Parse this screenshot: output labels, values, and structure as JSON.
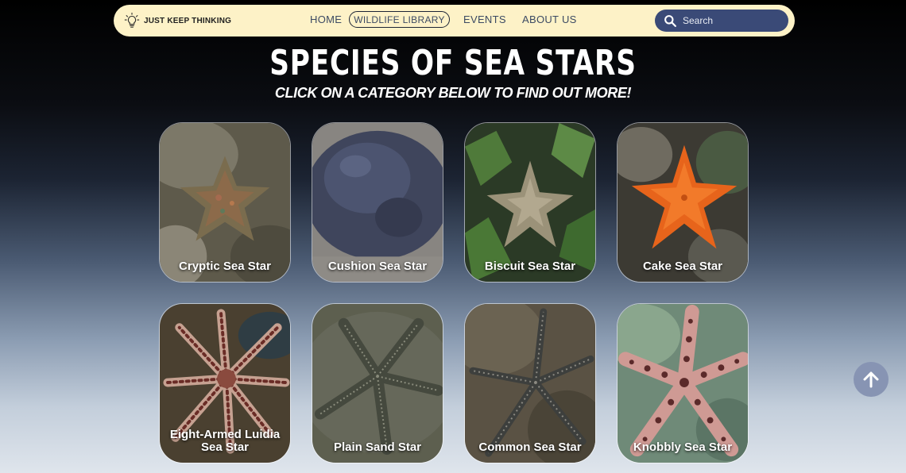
{
  "header": {
    "logo_text": "JUST KEEP THINKING",
    "nav": [
      {
        "label": "HOME"
      },
      {
        "label": "WILDLIFE LIBRARY",
        "active": true
      },
      {
        "label": "EVENTS"
      },
      {
        "label": "ABOUT US"
      }
    ],
    "search": {
      "placeholder": "Search"
    }
  },
  "page": {
    "title": "SPECIES OF SEA STARS",
    "subtitle": "CLICK ON A CATEGORY BELOW TO FIND OUT MORE!"
  },
  "species": [
    {
      "line1": "Cryptic Sea Star",
      "line2": ""
    },
    {
      "line1": "Cushion Sea Star",
      "line2": ""
    },
    {
      "line1": "Biscuit Sea Star",
      "line2": ""
    },
    {
      "line1": "Cake Sea Star",
      "line2": ""
    },
    {
      "line1": "Eight-Armed Luidia",
      "line2": "Sea Star"
    },
    {
      "line1": "Plain Sand Star",
      "line2": ""
    },
    {
      "line1": "Common Sea Star",
      "line2": ""
    },
    {
      "line1": "Knobbly Sea Star",
      "line2": ""
    }
  ],
  "colors": {
    "navbar_bg": "#fdf2c7",
    "search_bg": "#3a4a77",
    "scroll_button_bg": "#8794b3"
  }
}
